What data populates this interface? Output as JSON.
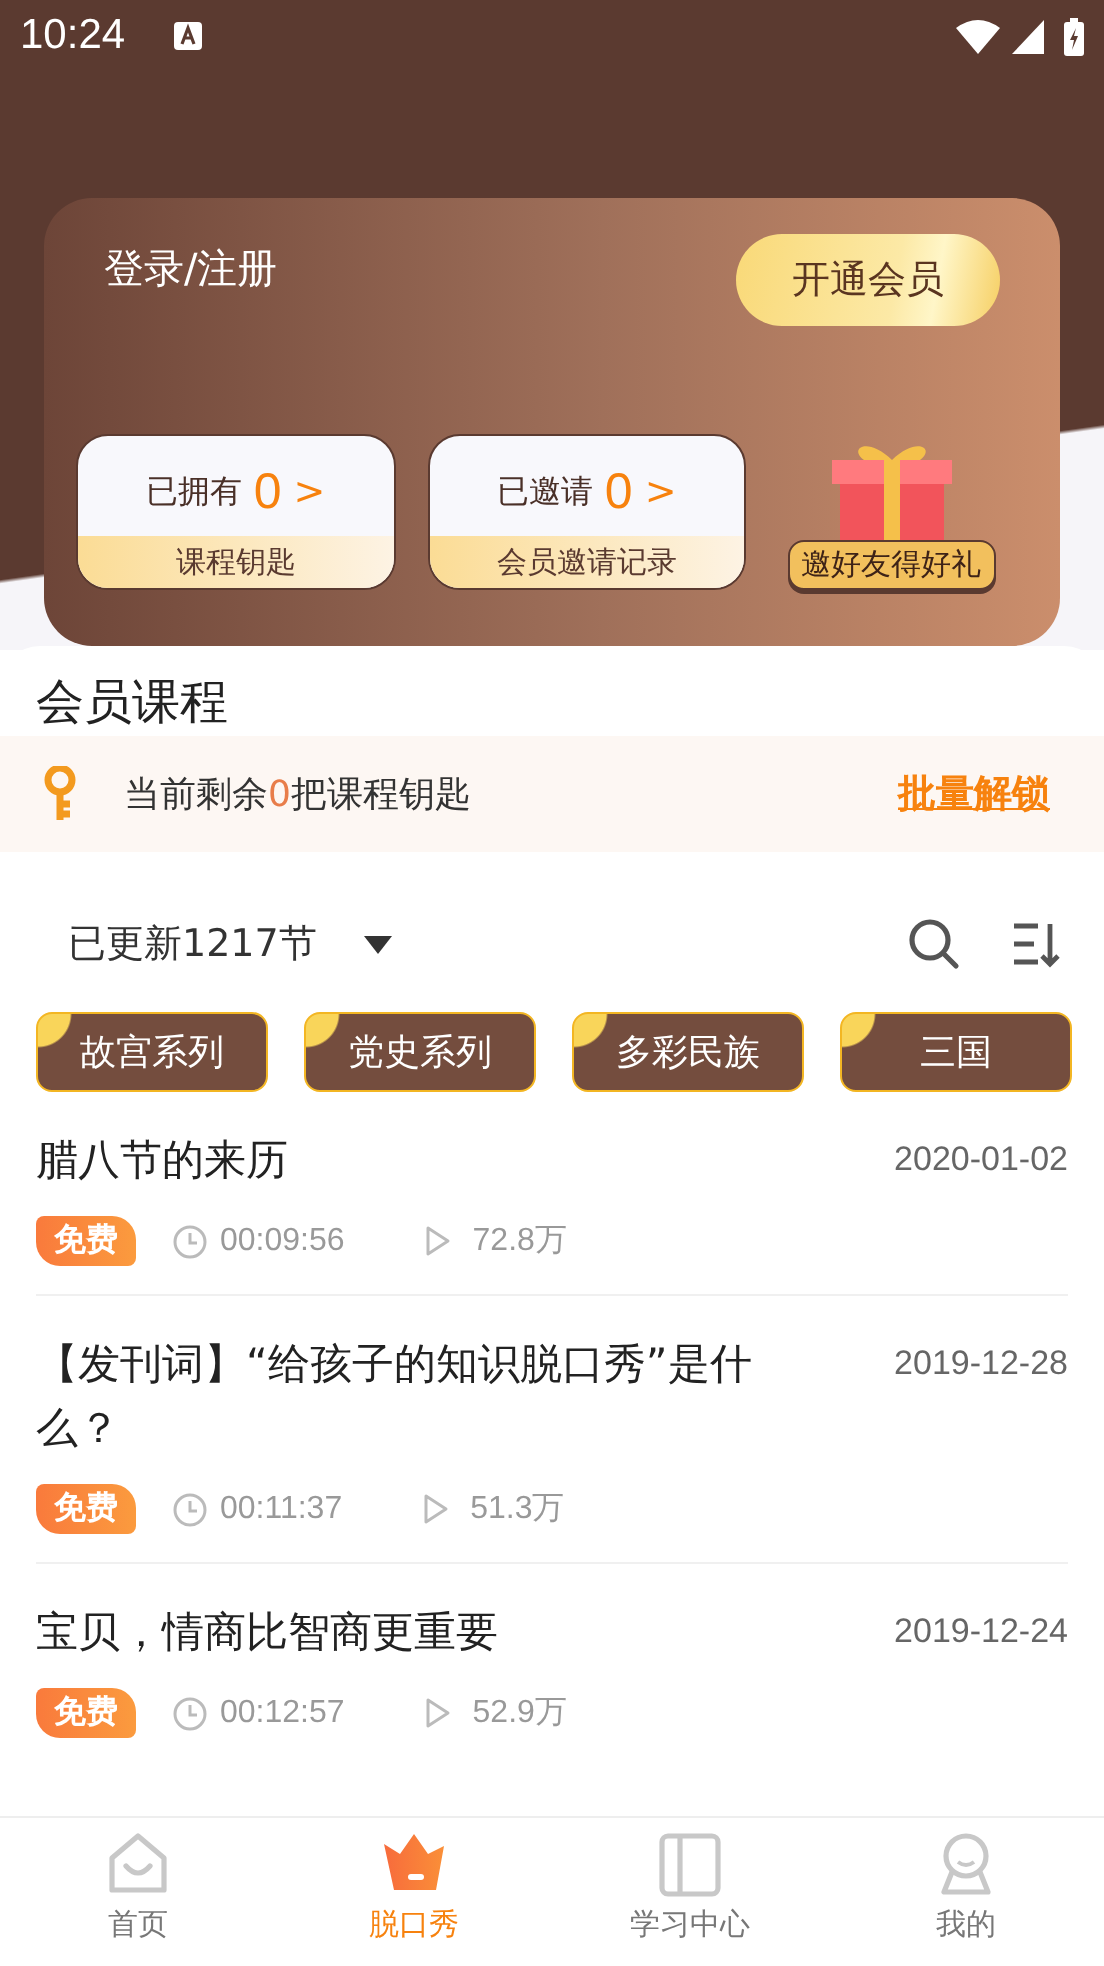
{
  "status_bar": {
    "time": "10:24"
  },
  "member_card": {
    "login": "登录/注册",
    "vip_button": "开通会员",
    "stats": [
      {
        "label": "已拥有",
        "value": "0",
        "arrow": ">",
        "sub": "课程钥匙"
      },
      {
        "label": "已邀请",
        "value": "0",
        "arrow": ">",
        "sub": "会员邀请记录"
      }
    ],
    "gift_label": "邀好友得好礼"
  },
  "section_title": "会员课程",
  "key_banner": {
    "prefix": "当前剩余",
    "count": "0",
    "suffix": "把课程钥匙",
    "action": "批量解锁"
  },
  "filter": {
    "label": "已更新1217节"
  },
  "tags": [
    "故宫系列",
    "党史系列",
    "多彩民族",
    "三国"
  ],
  "courses": [
    {
      "title": "腊八节的来历",
      "date": "2020-01-02",
      "badge": "免费",
      "duration": "00:09:56",
      "plays": "72.8万"
    },
    {
      "title": "【发刊词】“给孩子的知识脱口秀”是什么？",
      "date": "2019-12-28",
      "badge": "免费",
      "duration": "00:11:37",
      "plays": "51.3万"
    },
    {
      "title": "宝贝，情商比智商更重要",
      "date": "2019-12-24",
      "badge": "免费",
      "duration": "00:12:57",
      "plays": "52.9万"
    }
  ],
  "tabs": [
    {
      "label": "首页",
      "kind": "home",
      "selected": false
    },
    {
      "label": "脱口秀",
      "kind": "crown",
      "selected": true
    },
    {
      "label": "学习中心",
      "kind": "book",
      "selected": false
    },
    {
      "label": "我的",
      "kind": "person",
      "selected": false
    }
  ]
}
